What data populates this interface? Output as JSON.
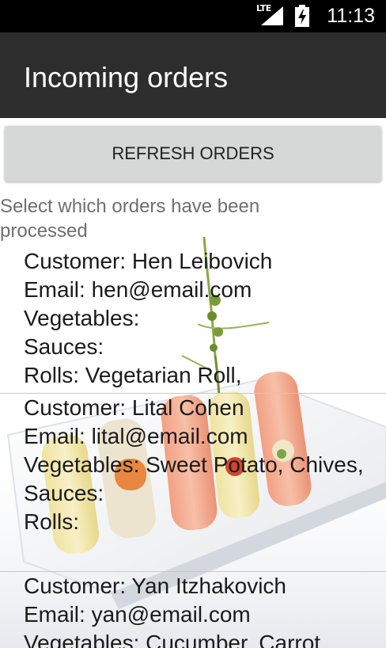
{
  "status_bar": {
    "network": "LTE",
    "time": "11:13"
  },
  "app_bar": {
    "title": "Incoming orders"
  },
  "main": {
    "refresh_label": "REFRESH ORDERS",
    "instruction": "Select which orders have been processed",
    "orders": [
      {
        "customer": "Customer: Hen Leibovich",
        "email": "Email: hen@email.com",
        "vegetables": "Vegetables:",
        "sauces": "Sauces:",
        "rolls": "Rolls: Vegetarian Roll,"
      },
      {
        "customer": "Customer: Lital Cohen",
        "email": "Email: lital@email.com",
        "vegetables": "Vegetables: Sweet Potato, Chives,",
        "sauces": "Sauces:",
        "rolls": "Rolls:"
      },
      {
        "customer": "Customer: Yan Itzhakovich",
        "email": "Email: yan@email.com",
        "vegetables": "Vegetables: Cucumber, Carrot"
      }
    ]
  }
}
